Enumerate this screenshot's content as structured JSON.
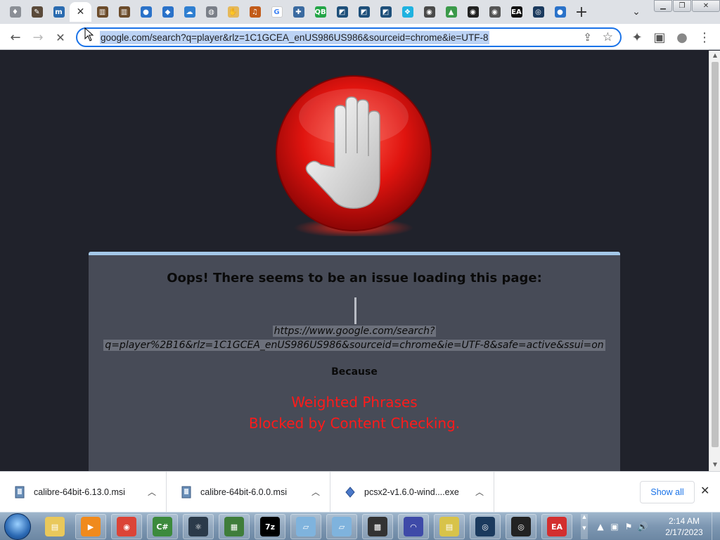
{
  "browser": {
    "tabs": [
      {
        "icon": "gem-icon",
        "color": "#8b8f96",
        "glyph": "♦"
      },
      {
        "icon": "pen-tablet-icon",
        "color": "#5a4a3a",
        "glyph": "✎"
      },
      {
        "icon": "m-app-icon",
        "color": "#2a6bb0",
        "glyph": "m"
      },
      {
        "icon": "close-icon",
        "color": "#ffffff",
        "glyph": "✕"
      },
      {
        "icon": "library-icon",
        "color": "#6b4b2a",
        "glyph": "▥"
      },
      {
        "icon": "library-icon",
        "color": "#6b4b2a",
        "glyph": "▥"
      },
      {
        "icon": "map-pin-icon",
        "color": "#2a72c9",
        "glyph": "●"
      },
      {
        "icon": "diamond-icon",
        "color": "#2a72c9",
        "glyph": "◆"
      },
      {
        "icon": "cloud-icon",
        "color": "#2f7fd1",
        "glyph": "☁"
      },
      {
        "icon": "ball-icon",
        "color": "#7a7f88",
        "glyph": "◍"
      },
      {
        "icon": "hand-icon",
        "color": "#e5b85a",
        "glyph": "✋"
      },
      {
        "icon": "headphones-icon",
        "color": "#c25b19",
        "glyph": "♫"
      },
      {
        "icon": "google-icon",
        "color": "#ffffff",
        "glyph": "G"
      },
      {
        "icon": "puzzle-icon",
        "color": "#3a6aa0",
        "glyph": "✚"
      },
      {
        "icon": "qb-icon",
        "color": "#23a547",
        "glyph": "QB"
      },
      {
        "icon": "box-icon",
        "color": "#1d4f7a",
        "glyph": "◩"
      },
      {
        "icon": "box-icon",
        "color": "#1d4f7a",
        "glyph": "◩"
      },
      {
        "icon": "box-icon",
        "color": "#1d4f7a",
        "glyph": "◩"
      },
      {
        "icon": "kodi-icon",
        "color": "#1fb2e0",
        "glyph": "❖"
      },
      {
        "icon": "disc-icon",
        "color": "#4a4a4a",
        "glyph": "◉"
      },
      {
        "icon": "drive-icon",
        "color": "#3b9a4a",
        "glyph": "▲"
      },
      {
        "icon": "obs-icon",
        "color": "#222222",
        "glyph": "◉"
      },
      {
        "icon": "disc-icon",
        "color": "#555555",
        "glyph": "◉"
      },
      {
        "icon": "ea-icon",
        "color": "#111111",
        "glyph": "EA"
      },
      {
        "icon": "steam-icon",
        "color": "#1b3a5e",
        "glyph": "◎"
      },
      {
        "icon": "map-pin-icon",
        "color": "#2a72c9",
        "glyph": "●"
      }
    ],
    "new_tab": "+",
    "tab_search": "⌄",
    "window_buttons": {
      "minimize": "▁",
      "restore": "❐",
      "close": "✕"
    },
    "nav": {
      "back": "←",
      "forward": "→",
      "reload": "✕"
    },
    "address": "google.com/search?q=player&rlz=1C1GCEA_enUS986US986&sourceid=chrome&ie=UTF-8",
    "share": "⇪",
    "star": "☆",
    "extensions": "✦",
    "sidepanel": "▣",
    "profile": "●",
    "menu": "⋮"
  },
  "block_page": {
    "title": "Oops! There seems to be an issue loading this page:",
    "url_line1": "https://www.google.com/search?",
    "url_line2": "q=player%2B16&rlz=1C1GCEA_enUS986US986&sourceid=chrome&ie=UTF-8&safe=active&ssui=on",
    "because": "Because",
    "reason_line1": "Weighted Phrases",
    "reason_line2": "Blocked by Content Checking."
  },
  "downloads": {
    "items": [
      {
        "name": "calibre-64bit-6.13.0.msi"
      },
      {
        "name": "calibre-64bit-6.0.0.msi"
      },
      {
        "name": "pcsx2-v1.6.0-wind....exe"
      }
    ],
    "show_all": "Show all",
    "close": "✕"
  },
  "taskbar": {
    "apps": [
      {
        "name": "explorer",
        "color": "#e9c85b",
        "glyph": "▤"
      },
      {
        "name": "media-player",
        "color": "#f08a1c",
        "glyph": "▶"
      },
      {
        "name": "chrome",
        "color": "#db4437",
        "glyph": "◉"
      },
      {
        "name": "csharp",
        "color": "#3c8a3c",
        "glyph": "C#"
      },
      {
        "name": "atom",
        "color": "#2b3a4a",
        "glyph": "⚛"
      },
      {
        "name": "spreadsheet",
        "color": "#3f7d3a",
        "glyph": "▦"
      },
      {
        "name": "7zip",
        "color": "#000000",
        "glyph": "7z"
      },
      {
        "name": "notepad",
        "color": "#7fb3dd",
        "glyph": "▱"
      },
      {
        "name": "notepad2",
        "color": "#7fb3dd",
        "glyph": "▱"
      },
      {
        "name": "chip",
        "color": "#333333",
        "glyph": "▩"
      },
      {
        "name": "arc",
        "color": "#3e4aa8",
        "glyph": "◠"
      },
      {
        "name": "folders",
        "color": "#d8c34a",
        "glyph": "▤"
      },
      {
        "name": "steam",
        "color": "#1b3a5e",
        "glyph": "◎"
      },
      {
        "name": "uplay",
        "color": "#222222",
        "glyph": "◎"
      },
      {
        "name": "ea",
        "color": "#d32f2f",
        "glyph": "EA"
      }
    ],
    "tray": [
      "▲",
      "▣",
      "⚑",
      "🔊"
    ],
    "time": "2:14 AM",
    "date": "2/17/2023"
  }
}
